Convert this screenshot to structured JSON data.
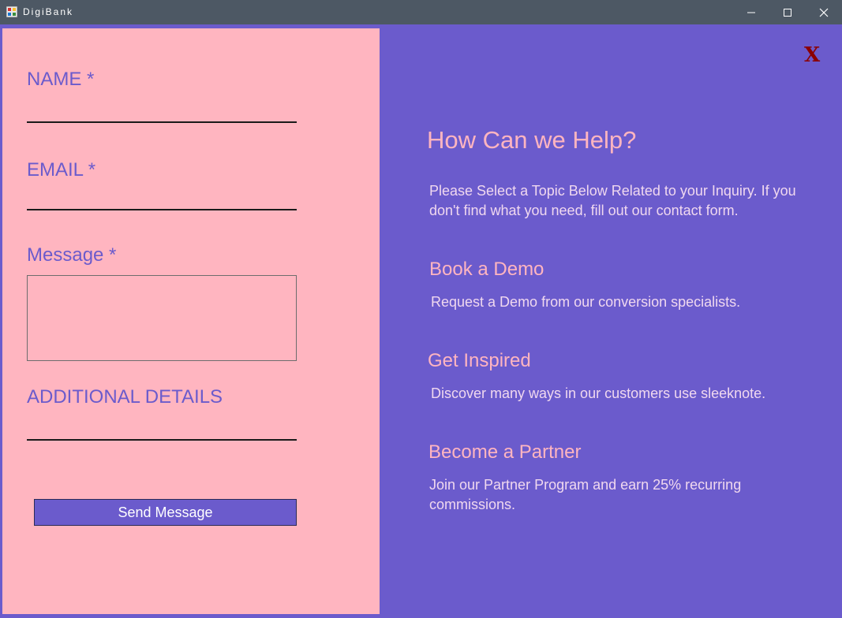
{
  "window": {
    "title": "DigiBank",
    "minimize_glyph": "—",
    "maximize_glyph": "☐",
    "close_glyph": "✕"
  },
  "form": {
    "name_label": "NAME *",
    "name_value": "",
    "email_label": "EMAIL *",
    "email_value": "",
    "message_label": "Message *",
    "message_value": "",
    "details_label": "ADDITIONAL DETAILS",
    "details_value": "",
    "send_label": "Send Message"
  },
  "help": {
    "close_label": "X",
    "title": "How Can we Help?",
    "intro": "Please Select a Topic Below Related to your Inquiry. If you don't find what you need, fill out our contact form.",
    "topics": [
      {
        "title": "Book a Demo",
        "description": "Request a Demo from our conversion specialists."
      },
      {
        "title": "Get Inspired",
        "description": "Discover many ways in our customers use sleeknote."
      },
      {
        "title": "Become a Partner",
        "description": "Join our Partner Program and earn 25% recurring commissions."
      }
    ]
  },
  "colors": {
    "left_panel": "#ffb5c0",
    "right_panel": "#6b5bcc",
    "label": "#6b5bcc",
    "topic_title": "#ffb5c0",
    "close_x": "#8b0000"
  }
}
